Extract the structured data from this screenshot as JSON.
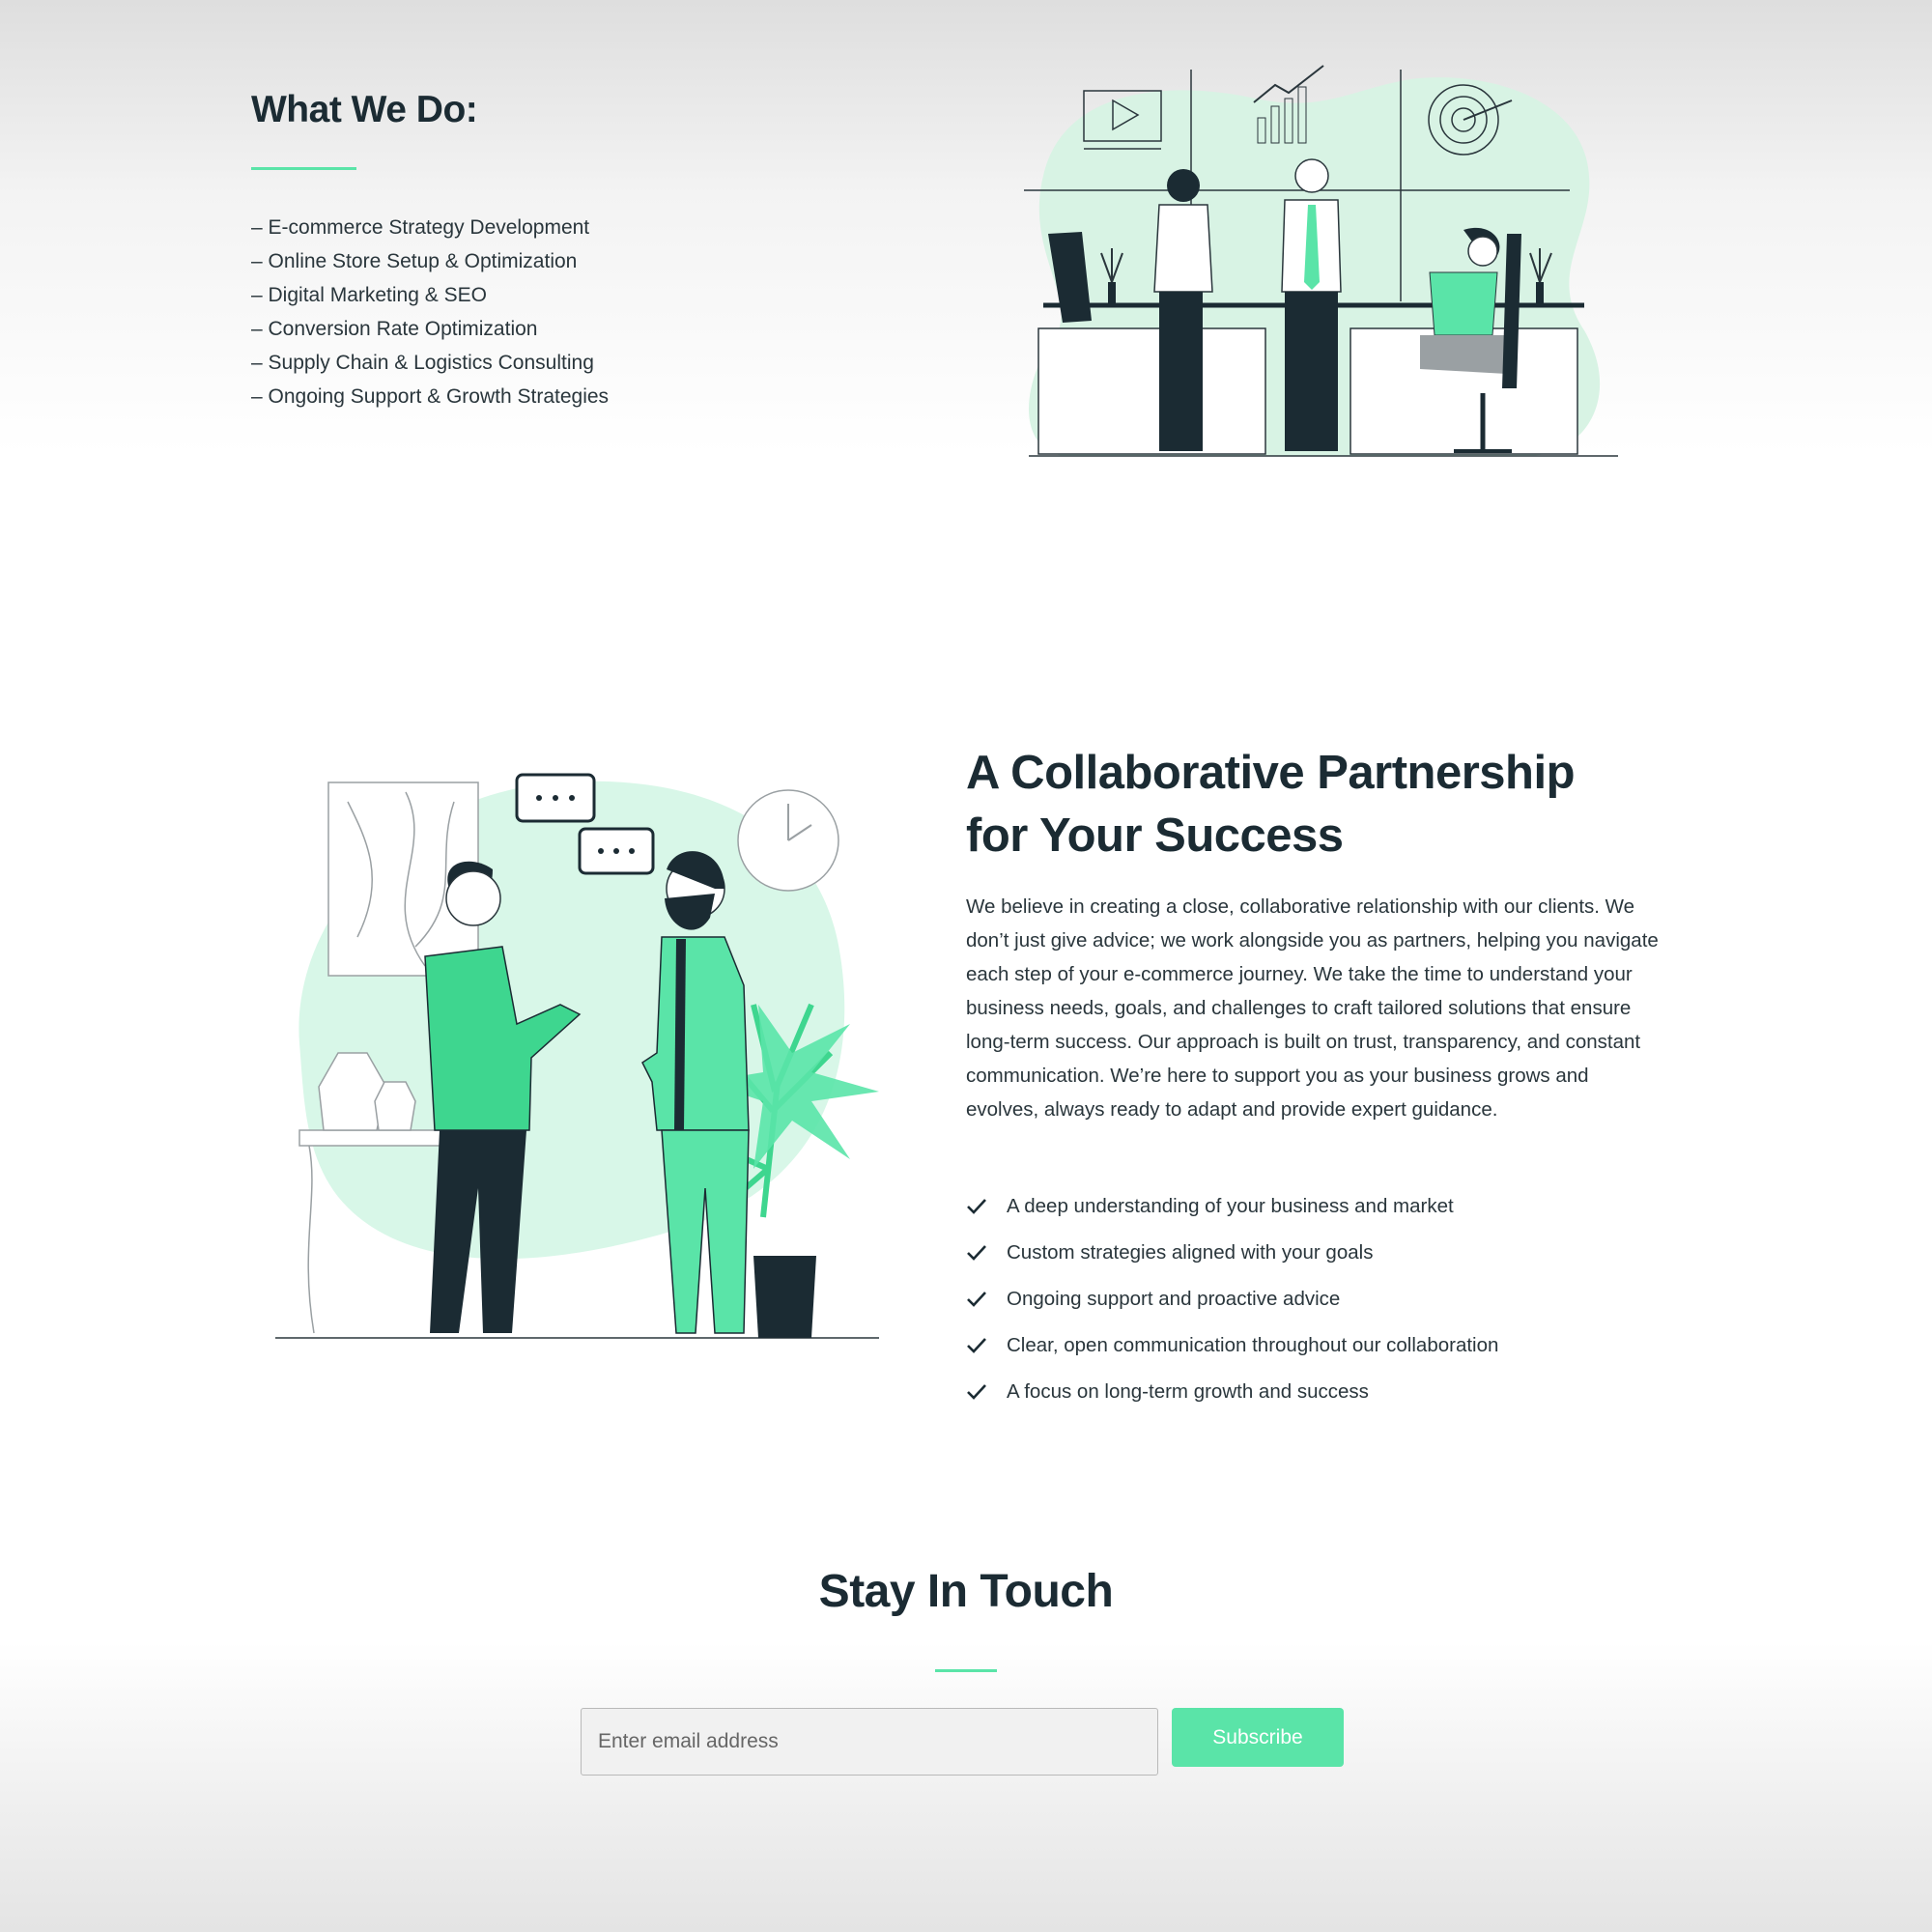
{
  "what_we_do": {
    "title": "What We Do:",
    "items": [
      "– E-commerce Strategy Development",
      "– Online Store Setup & Optimization",
      "– Digital Marketing & SEO",
      "– Conversion Rate Optimization",
      "– Supply Chain & Logistics Consulting",
      "– Ongoing Support & Growth Strategies"
    ]
  },
  "collaboration": {
    "title_line1": "A Collaborative Partnership",
    "title_line2": "for Your Success",
    "body": "We believe in creating a close, collaborative relationship with our clients. We don’t just give advice; we work alongside you as partners, helping you navigate each step of your e-commerce journey. We take the time to understand your business needs, goals, and challenges to craft tailored solutions that ensure long-term success. Our approach is built on trust, transparency, and constant communication. We’re here to support you as your business grows and evolves, always ready to adapt and provide expert guidance.",
    "benefits": [
      "A deep understanding of your business and market",
      "Custom strategies aligned with your goals",
      "Ongoing support and proactive advice",
      "Clear, open communication throughout our collaboration",
      "A focus on long-term growth and success"
    ]
  },
  "newsletter": {
    "title": "Stay In Touch",
    "email_placeholder": "Enter email address",
    "email_value": "",
    "subscribe_label": "Subscribe"
  },
  "icons": {
    "benefit_check": "check-icon"
  },
  "colors": {
    "accent": "#5ae4a8",
    "accent_light": "#d8f7e8",
    "heading": "#1b2b33",
    "text": "#2a363c"
  }
}
